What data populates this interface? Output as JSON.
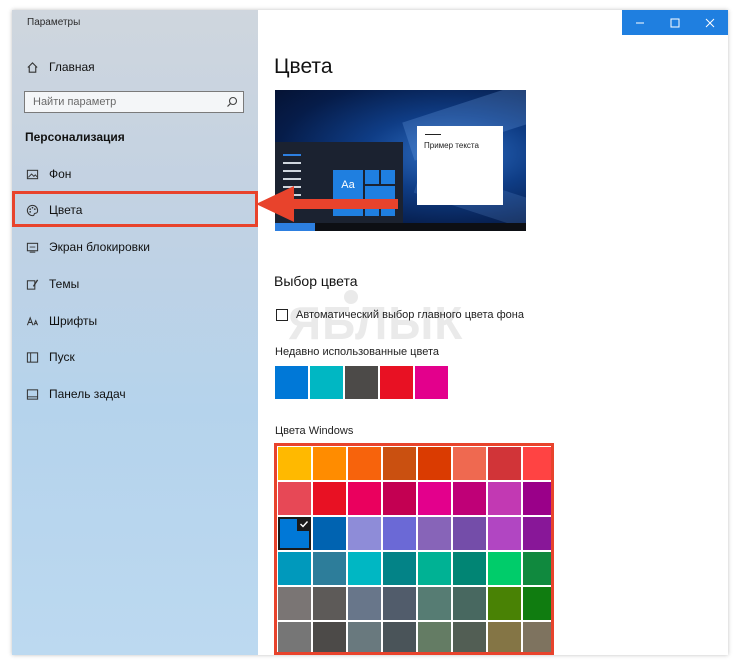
{
  "app": {
    "title": "Параметры"
  },
  "sidebar": {
    "home_label": "Главная",
    "search_placeholder": "Найти параметр",
    "section_title": "Персонализация",
    "items": [
      {
        "label": "Фон",
        "icon": "image-icon"
      },
      {
        "label": "Цвета",
        "icon": "palette-icon"
      },
      {
        "label": "Экран блокировки",
        "icon": "lock-screen-icon"
      },
      {
        "label": "Темы",
        "icon": "themes-icon"
      },
      {
        "label": "Шрифты",
        "icon": "fonts-icon"
      },
      {
        "label": "Пуск",
        "icon": "start-icon"
      },
      {
        "label": "Панель задач",
        "icon": "taskbar-icon"
      }
    ]
  },
  "main": {
    "title": "Цвета",
    "preview": {
      "sample_text": "Пример текста",
      "tile_text": "Aa"
    },
    "color_choice_title": "Выбор цвета",
    "auto_color_label": "Автоматический выбор главного цвета фона",
    "auto_color_checked": false,
    "recent_label": "Недавно использованные цвета",
    "recent_colors": [
      "#0078d7",
      "#00b7c3",
      "#4c4a48",
      "#e81123",
      "#e3008c"
    ],
    "windows_colors_label": "Цвета Windows",
    "windows_colors": [
      [
        "#ffb900",
        "#ff8c00",
        "#f7630c",
        "#ca5010",
        "#da3b01",
        "#ef6950",
        "#d13438",
        "#ff4343"
      ],
      [
        "#e74856",
        "#e81123",
        "#ea005e",
        "#c30052",
        "#e3008c",
        "#bf0077",
        "#c239b3",
        "#9a0089"
      ],
      [
        "#0078d7",
        "#0063b1",
        "#8e8cd8",
        "#6b69d6",
        "#8764b8",
        "#744da9",
        "#b146c2",
        "#881798"
      ],
      [
        "#0099bc",
        "#2d7d9a",
        "#00b7c3",
        "#038387",
        "#00b294",
        "#018574",
        "#00cc6a",
        "#10893e"
      ],
      [
        "#7a7574",
        "#5d5a58",
        "#68768a",
        "#515c6b",
        "#567c73",
        "#486860",
        "#498205",
        "#107c10"
      ],
      [
        "#767676",
        "#4c4a48",
        "#69797e",
        "#4a5459",
        "#647c64",
        "#525e54",
        "#847545",
        "#7e735f"
      ]
    ],
    "selected_color": "#0078d7"
  },
  "watermark": "ЯБЛЫК",
  "colors": {
    "accent": "#0078d7",
    "annotation": "#e8432c"
  }
}
